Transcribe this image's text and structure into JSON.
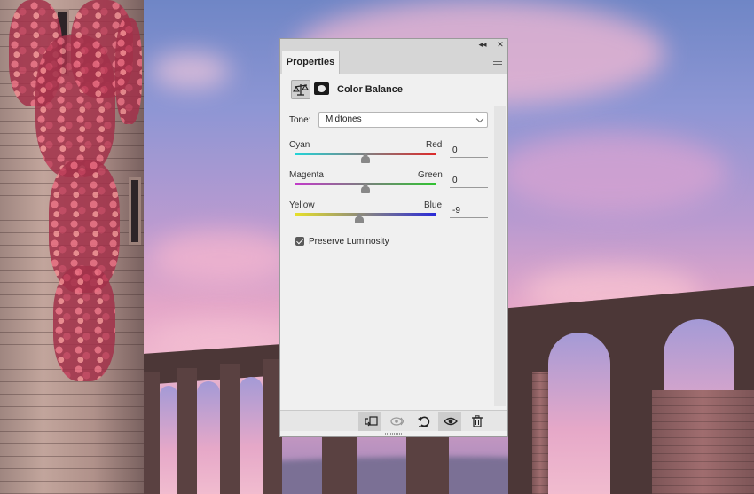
{
  "panel": {
    "title_controls": {
      "collapse_glyph": "◂◂",
      "close_glyph": "✕"
    },
    "tab_label": "Properties",
    "menu_icon": "panel-menu-icon",
    "adjustment": {
      "icon": "balance-scale-icon",
      "mask_icon": "layer-mask-icon",
      "title": "Color Balance"
    },
    "tone": {
      "label": "Tone:",
      "value": "Midtones"
    },
    "sliders": [
      {
        "left_label": "Cyan",
        "right_label": "Red",
        "value": "0",
        "min": -100,
        "max": 100,
        "level": 0,
        "gradient": [
          "#22d4d8",
          "#dd2a2a"
        ]
      },
      {
        "left_label": "Magenta",
        "right_label": "Green",
        "value": "0",
        "min": -100,
        "max": 100,
        "level": 0,
        "gradient": [
          "#c23bc9",
          "#31c331"
        ]
      },
      {
        "left_label": "Yellow",
        "right_label": "Blue",
        "value": "-9",
        "min": -100,
        "max": 100,
        "level": -9,
        "gradient": [
          "#e6e02a",
          "#2a2ad8"
        ]
      }
    ],
    "preserve_luminosity": {
      "label": "Preserve Luminosity",
      "checked": true
    },
    "footer_buttons": [
      "clip-to-layer-icon",
      "view-previous-state-icon",
      "reset-icon",
      "toggle-visibility-icon",
      "delete-icon"
    ]
  }
}
